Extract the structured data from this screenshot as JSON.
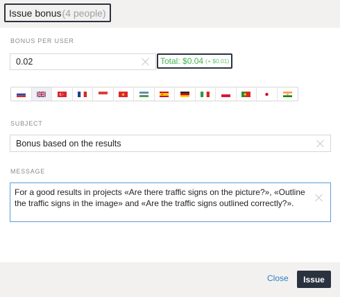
{
  "dialog": {
    "title": "Issue bonus",
    "people_count": "(4 people)"
  },
  "bonus": {
    "label": "BONUS PER USER",
    "value": "0.02",
    "total": "Total: $0.04",
    "fee": "(+ $0.01)"
  },
  "languages": [
    {
      "code": "ru",
      "icon": "flag-ru-icon"
    },
    {
      "code": "en",
      "icon": "flag-uk-icon",
      "selected": true
    },
    {
      "code": "tr",
      "icon": "flag-tr-icon"
    },
    {
      "code": "fr",
      "icon": "flag-fr-icon"
    },
    {
      "code": "id",
      "icon": "flag-id-icon"
    },
    {
      "code": "vi",
      "icon": "flag-vn-icon"
    },
    {
      "code": "uz",
      "icon": "flag-uz-icon"
    },
    {
      "code": "es",
      "icon": "flag-es-icon"
    },
    {
      "code": "de",
      "icon": "flag-de-icon"
    },
    {
      "code": "it",
      "icon": "flag-it-icon"
    },
    {
      "code": "pl",
      "icon": "flag-pl-icon"
    },
    {
      "code": "pt",
      "icon": "flag-pt-icon"
    },
    {
      "code": "ja",
      "icon": "flag-jp-icon"
    },
    {
      "code": "hi",
      "icon": "flag-in-icon"
    }
  ],
  "subject": {
    "label": "SUBJECT",
    "value": "Bonus based on the results"
  },
  "message": {
    "label": "MESSAGE",
    "value": "For a good results in projects «Are there traffic signs on the picture?», «Outline the traffic signs in the image» and «Are the traffic signs outlined correctly?»."
  },
  "footer": {
    "close_label": "Close",
    "issue_label": "Issue"
  },
  "colors": {
    "accent_dark": "#2a3240",
    "total_green": "#3fb34f",
    "link_blue": "#2d7dc8",
    "focus_border": "#5b9bd5"
  }
}
